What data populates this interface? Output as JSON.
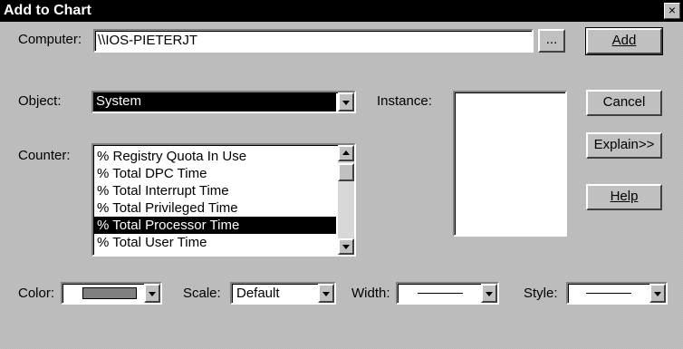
{
  "window": {
    "title": "Add to Chart",
    "close_glyph": "×"
  },
  "computer": {
    "label": "Computer:",
    "value": "\\\\IOS-PIETERJT",
    "browse_label": "..."
  },
  "object": {
    "label": "Object:",
    "value": "System"
  },
  "instance": {
    "label": "Instance:"
  },
  "counter": {
    "label": "Counter:",
    "items": [
      "% Registry Quota In Use",
      "% Total DPC Time",
      "% Total Interrupt Time",
      "% Total Privileged Time",
      "% Total Processor Time",
      "% Total User Time"
    ],
    "selected_index": 4
  },
  "buttons": {
    "add": "Add",
    "cancel": "Cancel",
    "explain": "Explain>>",
    "help": "Help"
  },
  "color": {
    "label": "Color:",
    "swatch": "#808080"
  },
  "scale": {
    "label": "Scale:",
    "value": "Default"
  },
  "width": {
    "label": "Width:"
  },
  "style": {
    "label": "Style:"
  }
}
